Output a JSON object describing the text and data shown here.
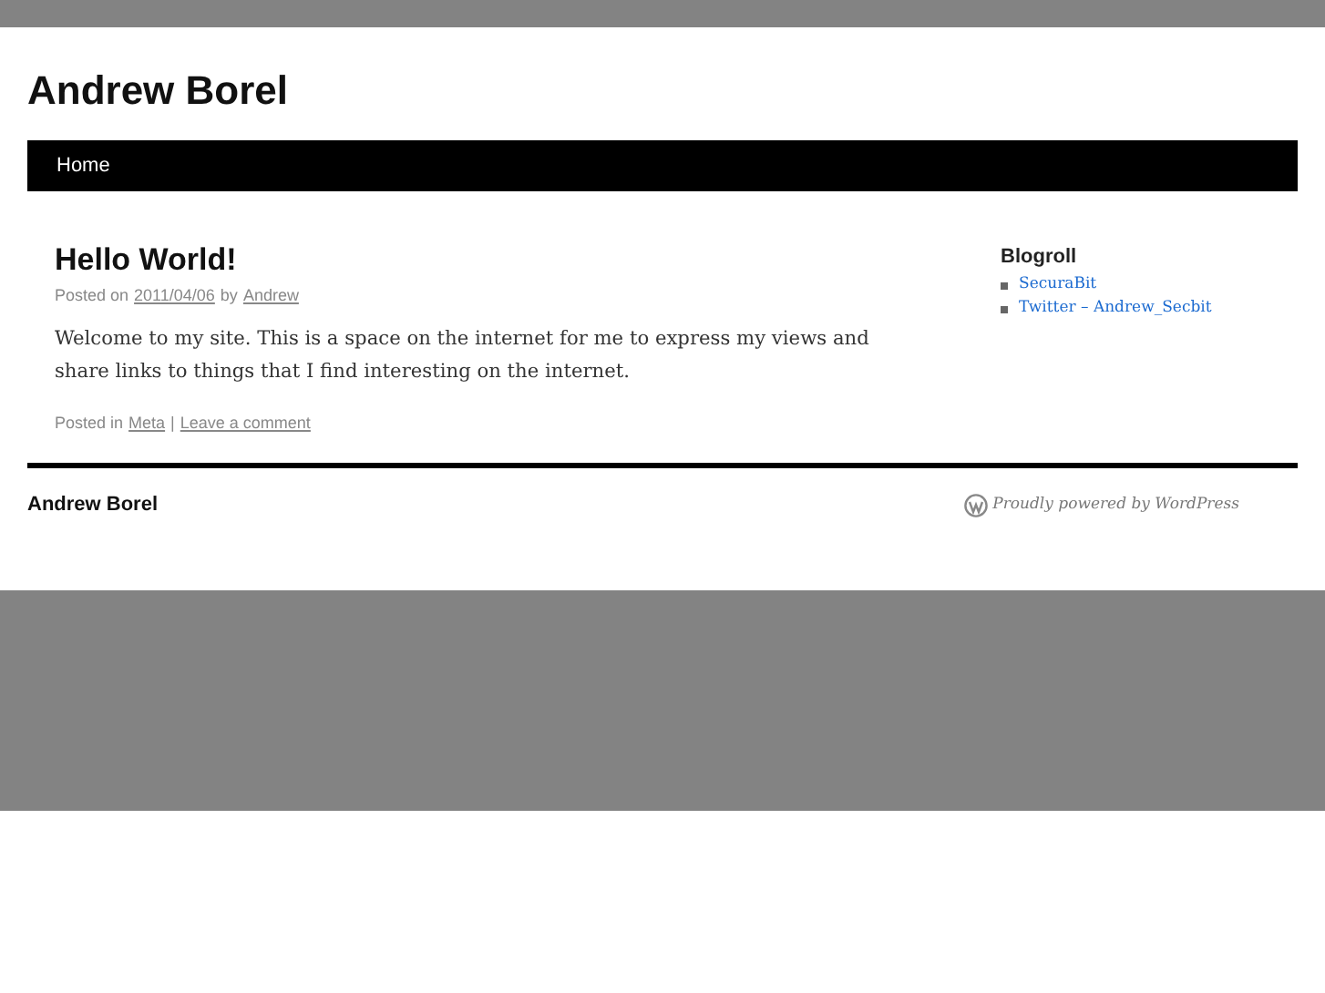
{
  "site_title": "Andrew Borel",
  "menu": [
    {
      "label": "Home",
      "selected": true
    }
  ],
  "post": {
    "title": "Hello World!",
    "meta": {
      "prefix": "Posted on",
      "date": "2011/04/06",
      "by": "by",
      "author": "Andrew"
    },
    "body": "Welcome to my site. This is a space on the internet for me to express my views and share links to things that I find interesting on the internet.",
    "footer": {
      "prefix": "Posted in",
      "category": "Meta",
      "separator": "|",
      "comment_link": "Leave a comment"
    }
  },
  "sidebar": {
    "title": "Blogroll",
    "links": [
      "SecuraBit",
      "Twitter – Andrew_Secbit"
    ]
  },
  "footer": {
    "site_title": "Andrew Borel",
    "powered_by": "Proudly powered by WordPress"
  }
}
